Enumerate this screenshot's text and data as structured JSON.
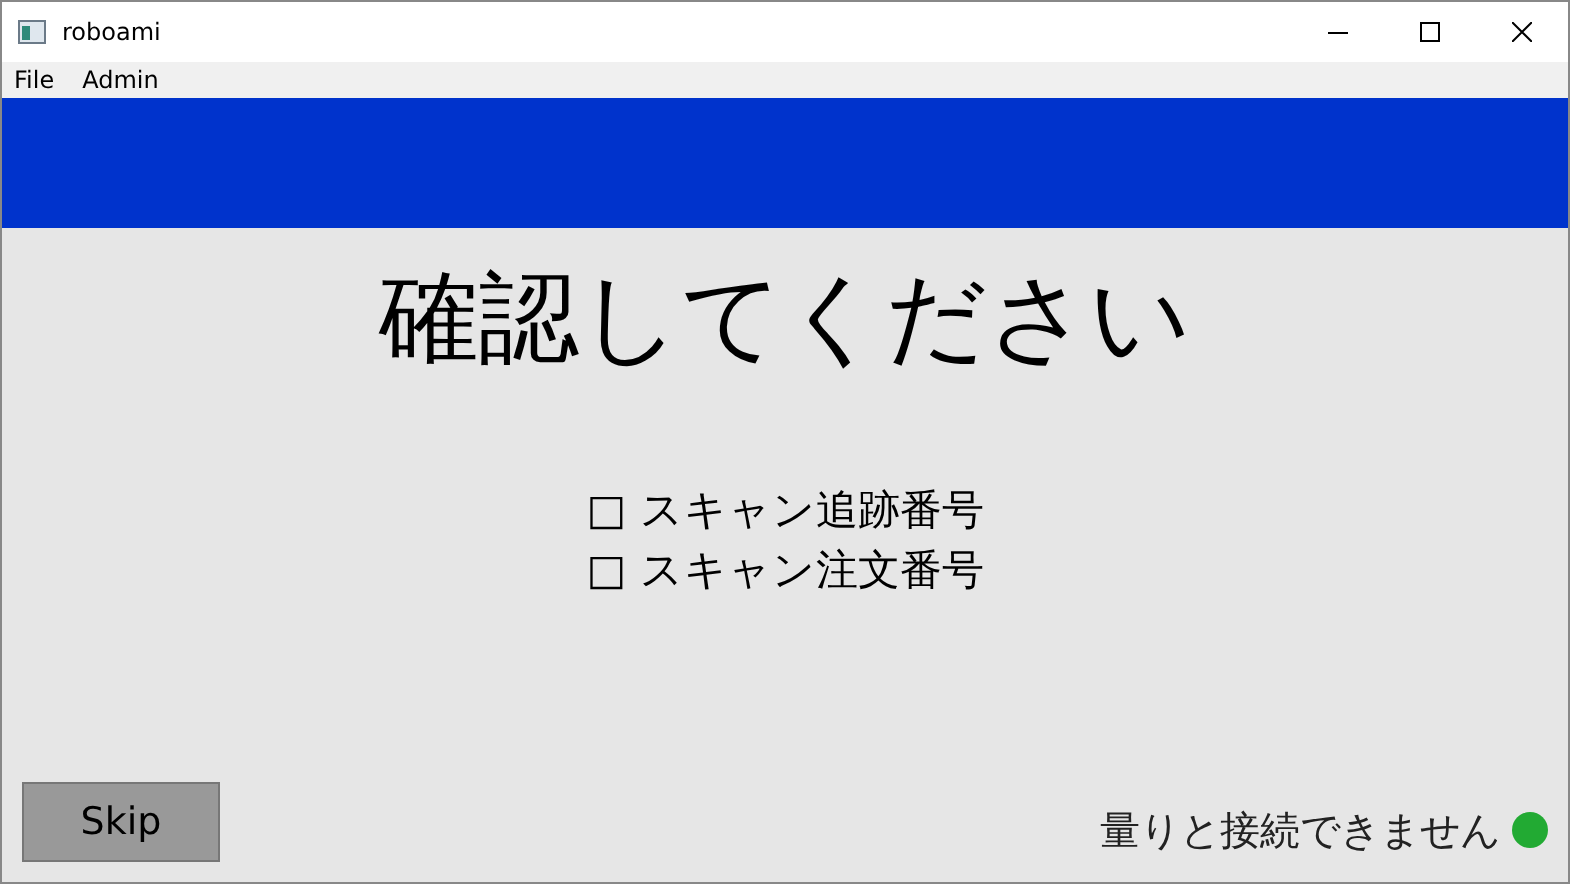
{
  "window": {
    "title": "roboami"
  },
  "menu": [
    "File",
    "Admin"
  ],
  "heading": "確認してください",
  "checklist": [
    "□ スキャン追跡番号",
    "□ スキャン注文番号"
  ],
  "skip_button": "Skip",
  "status": {
    "text": "量りと接続できません",
    "color": "#22aa33"
  }
}
